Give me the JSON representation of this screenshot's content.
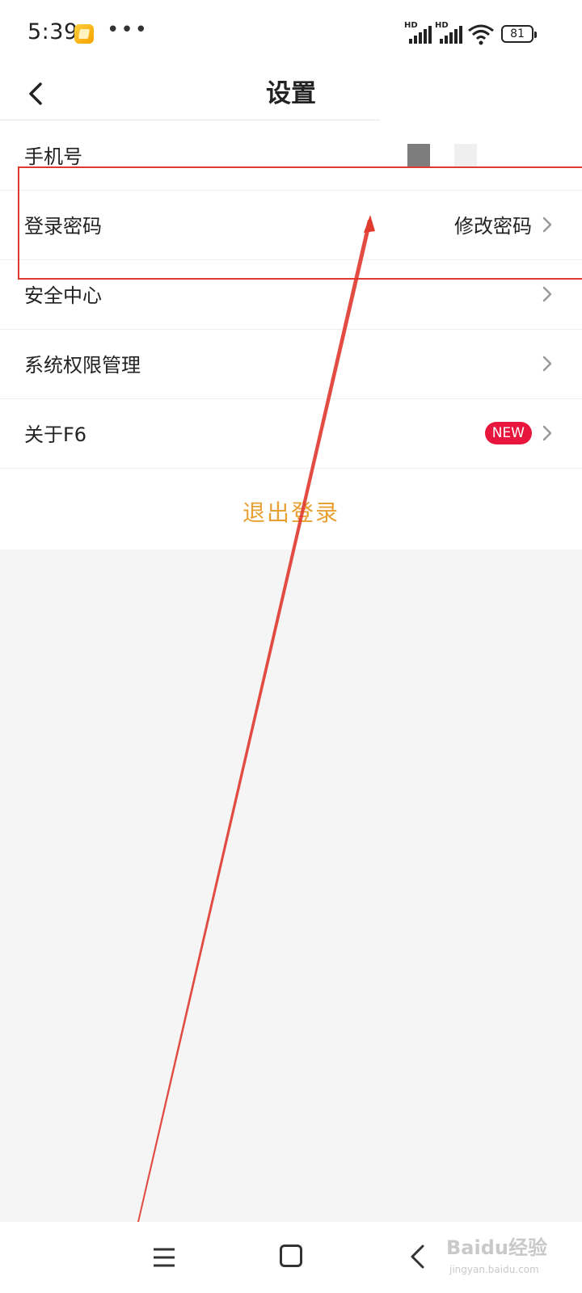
{
  "status_bar": {
    "time": "5:39",
    "more": "•••",
    "signal1_label": "HD",
    "signal2_label": "HD",
    "battery": "81",
    "icons": [
      "app-notification-icon",
      "signal-icon",
      "wifi-icon",
      "battery-icon"
    ]
  },
  "header": {
    "title": "设置",
    "back_icon": "chevron-left-icon"
  },
  "rows": [
    {
      "label": "手机号",
      "value": ""
    },
    {
      "label": "登录密码",
      "value": "修改密码"
    },
    {
      "label": "安全中心",
      "value": ""
    },
    {
      "label": "系统权限管理",
      "value": ""
    },
    {
      "label": "关于F6",
      "badge": "NEW"
    }
  ],
  "logout_label": "退出登录",
  "colors": {
    "accent": "#e8a033",
    "badge": "#e8163c",
    "annotation": "#e0392e",
    "background": "#f5f5f5"
  },
  "nav_bar": {
    "icons": [
      "menu-icon",
      "home-icon",
      "back-icon"
    ]
  },
  "watermark": {
    "main": "Baidu经验",
    "sub": "jingyan.baidu.com"
  }
}
